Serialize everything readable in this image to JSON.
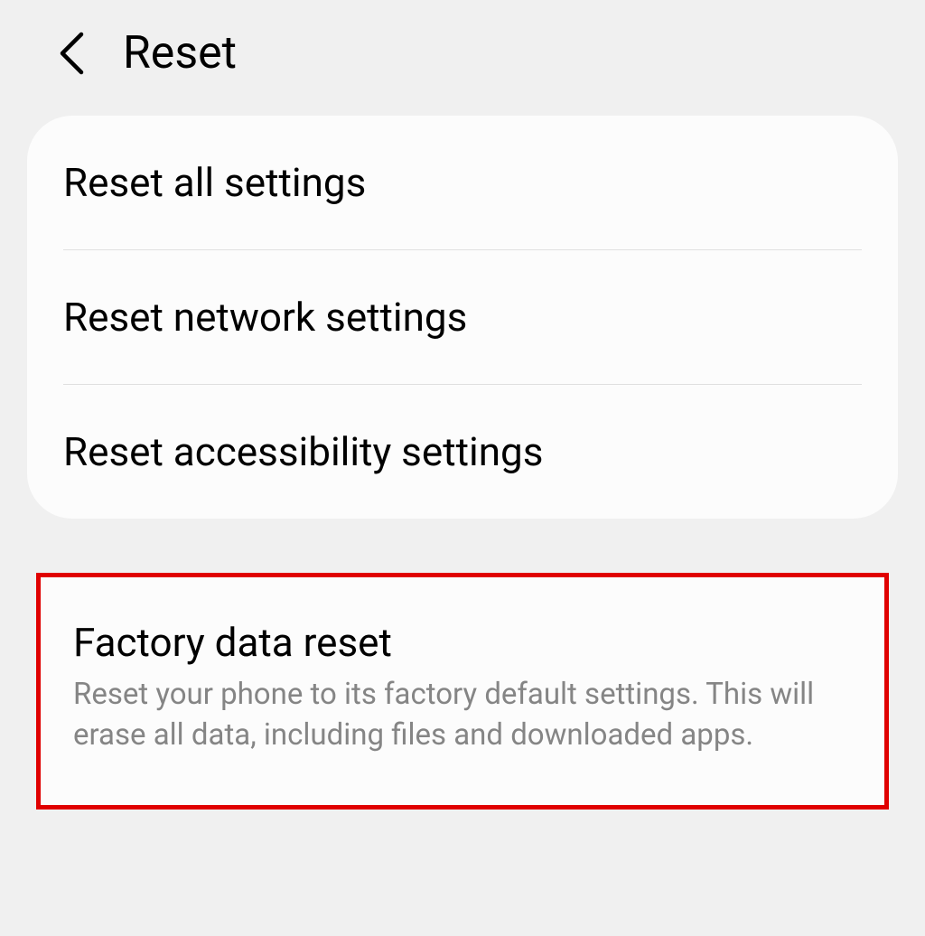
{
  "header": {
    "title": "Reset"
  },
  "group1": {
    "items": [
      {
        "title": "Reset all settings"
      },
      {
        "title": "Reset network settings"
      },
      {
        "title": "Reset accessibility settings"
      }
    ]
  },
  "group2": {
    "factory": {
      "title": "Factory data reset",
      "subtitle": "Reset your phone to its factory default settings. This will erase all data, including files and downloaded apps."
    }
  }
}
